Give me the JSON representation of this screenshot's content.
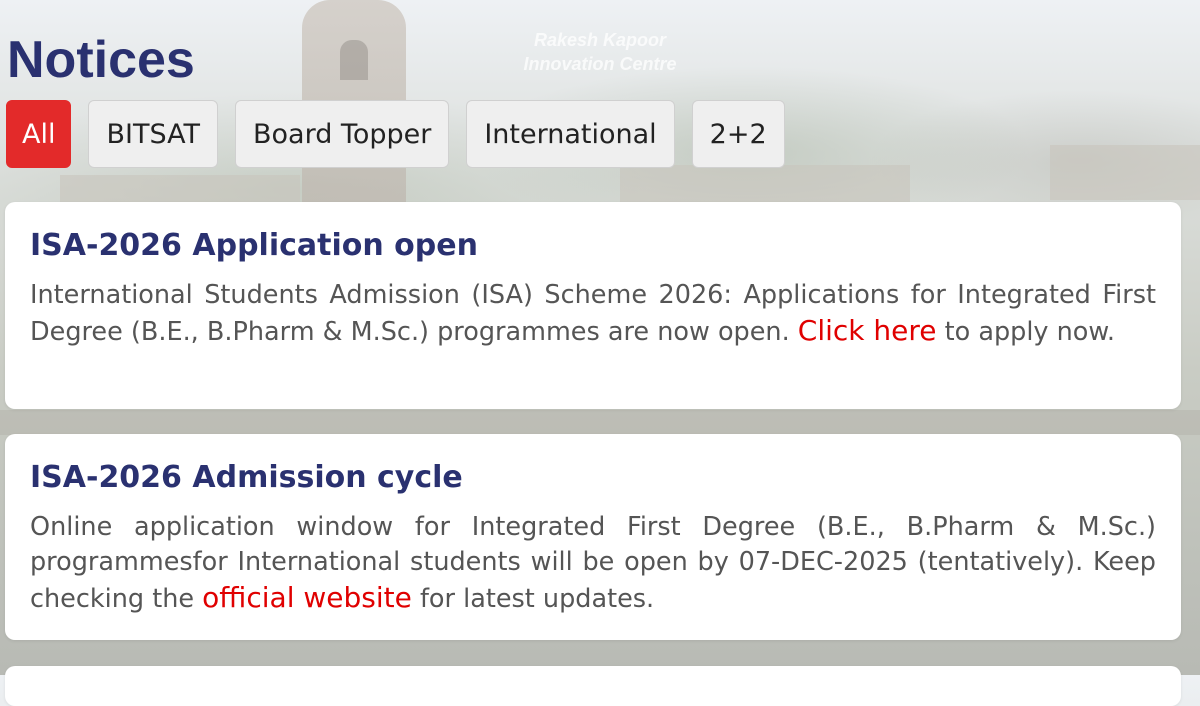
{
  "watermark": {
    "line1": "Rakesh Kapoor",
    "line2": "Innovation Centre"
  },
  "page_title": "Notices",
  "tabs": [
    {
      "label": "All",
      "active": true
    },
    {
      "label": "BITSAT",
      "active": false
    },
    {
      "label": "Board Topper",
      "active": false
    },
    {
      "label": "International",
      "active": false
    },
    {
      "label": "2+2",
      "active": false
    }
  ],
  "notices": [
    {
      "title": "ISA-2026 Application open",
      "text_before": "International Students Admission (ISA) Scheme 2026: Applications for Integrated First Degree (B.E., B.Pharm & M.Sc.) programmes are now open. ",
      "link_text": "Click here",
      "text_after": " to apply now."
    },
    {
      "title": "ISA-2026 Admission cycle",
      "text_before": "Online application window for Integrated First Degree (B.E., B.Pharm & M.Sc.) programmesfor International students will be open by 07-DEC-2025 (tentatively). Keep checking the ",
      "link_text": "official website",
      "text_after": " for latest updates."
    }
  ],
  "colors": {
    "accent": "#e32a2a",
    "title": "#2a3170",
    "link": "#e00000",
    "body_text": "#555555"
  }
}
